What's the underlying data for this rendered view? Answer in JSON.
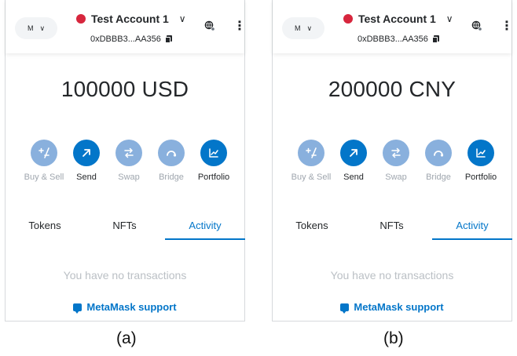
{
  "colors": {
    "primary": "#0376c9",
    "primary_light": "#89b0dd",
    "muted": "#bbc0c5",
    "text": "#24272a",
    "account_dot": "#d7263d"
  },
  "panels": [
    {
      "network_label": "M",
      "account_name": "Test Account 1",
      "address": "0xDBBB3...AA356",
      "balance": "100000 USD",
      "actions": [
        {
          "label": "Buy & Sell",
          "icon": "plus-minus-icon",
          "enabled": false
        },
        {
          "label": "Send",
          "icon": "arrow-up-right-icon",
          "enabled": true
        },
        {
          "label": "Swap",
          "icon": "swap-arrows-icon",
          "enabled": false
        },
        {
          "label": "Bridge",
          "icon": "bridge-icon",
          "enabled": false
        },
        {
          "label": "Portfolio",
          "icon": "chart-icon",
          "enabled": true
        }
      ],
      "tabs": [
        {
          "label": "Tokens"
        },
        {
          "label": "NFTs"
        },
        {
          "label": "Activity",
          "active": true
        }
      ],
      "empty_message": "You have no transactions",
      "support_label": "MetaMask support",
      "caption": "(a)"
    },
    {
      "network_label": "M",
      "account_name": "Test Account 1",
      "address": "0xDBBB3...AA356",
      "balance": "200000 CNY",
      "actions": [
        {
          "label": "Buy & Sell",
          "icon": "plus-minus-icon",
          "enabled": false
        },
        {
          "label": "Send",
          "icon": "arrow-up-right-icon",
          "enabled": true
        },
        {
          "label": "Swap",
          "icon": "swap-arrows-icon",
          "enabled": false
        },
        {
          "label": "Bridge",
          "icon": "bridge-icon",
          "enabled": false
        },
        {
          "label": "Portfolio",
          "icon": "chart-icon",
          "enabled": true
        }
      ],
      "tabs": [
        {
          "label": "Tokens"
        },
        {
          "label": "NFTs"
        },
        {
          "label": "Activity",
          "active": true
        }
      ],
      "empty_message": "You have no transactions",
      "support_label": "MetaMask support",
      "caption": "(b)"
    }
  ]
}
